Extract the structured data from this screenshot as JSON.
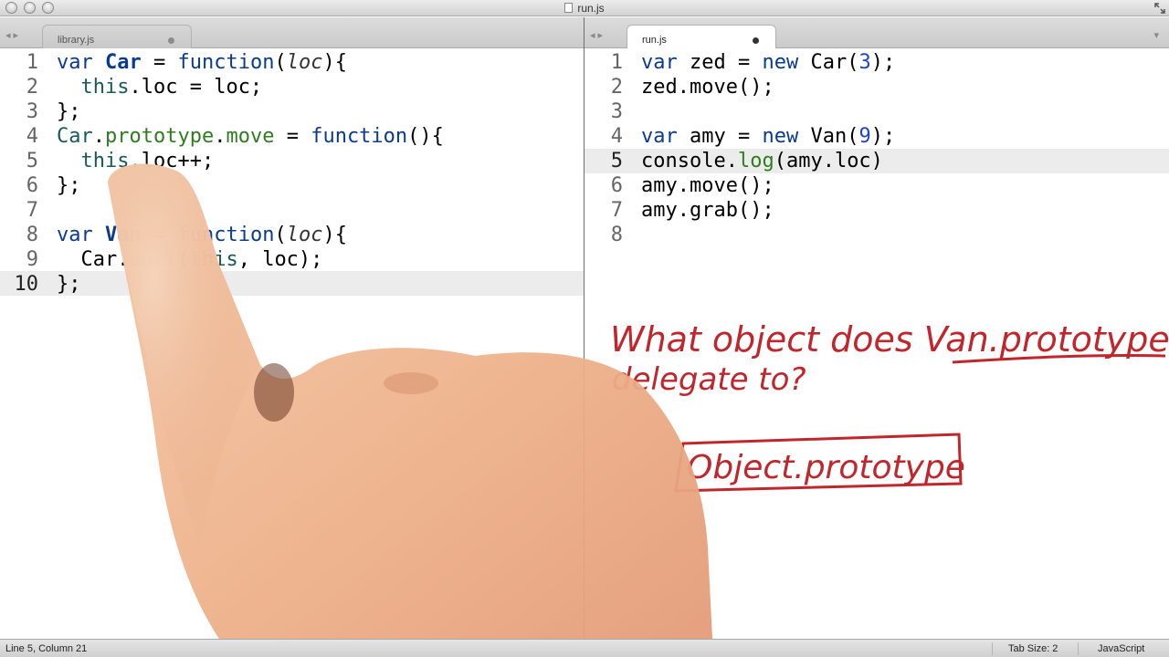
{
  "window": {
    "title": "run.js"
  },
  "tabs": {
    "left": {
      "label": "library.js"
    },
    "right": {
      "label": "run.js"
    }
  },
  "left_editor": {
    "line_numbers": [
      "1",
      "2",
      "3",
      "4",
      "5",
      "6",
      "7",
      "8",
      "9",
      "10"
    ],
    "current_line": 10
  },
  "right_editor": {
    "line_numbers": [
      "1",
      "2",
      "3",
      "4",
      "5",
      "6",
      "7",
      "8"
    ],
    "current_line": 5
  },
  "annotation": {
    "question_line1": "What object does Van.prototype",
    "question_line2": "delegate to?",
    "answer": "Object.prototype"
  },
  "status_bar": {
    "position": "Line 5, Column 21",
    "tab_size": "Tab Size: 2",
    "syntax": "JavaScript"
  },
  "colors": {
    "keyword": "#0b3b8c",
    "function_name": "#2f7d1e",
    "number": "#1f45c9",
    "handwriting": "#c0262b"
  }
}
